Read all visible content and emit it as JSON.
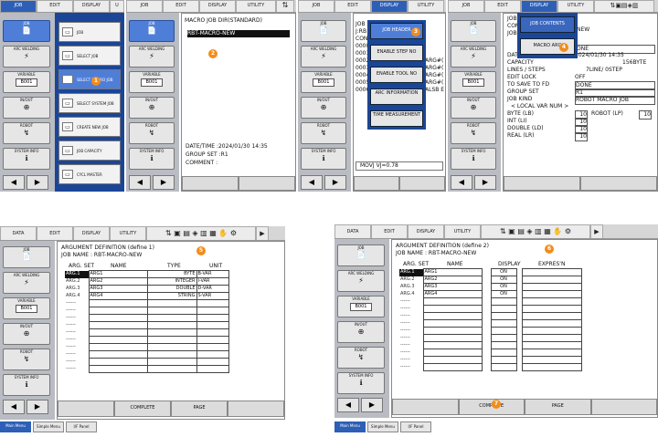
{
  "tabs": {
    "job": "JOB",
    "edit": "EDIT",
    "display": "DISPLAY",
    "utility": "UTILITY",
    "data": "DATA"
  },
  "mainmenu": [
    {
      "label": "JOB",
      "icon": "📄"
    },
    {
      "label": "ARC WELDING",
      "icon": "⚡"
    },
    {
      "label": "VARIABLE",
      "sub": "B001"
    },
    {
      "label": "IN/OUT",
      "icon": "⊕"
    },
    {
      "label": "ROBOT",
      "icon": "↯"
    },
    {
      "label": "SYSTEM INFO",
      "icon": "ℹ"
    }
  ],
  "jobmenu": [
    "JOB",
    "SELECT JOB",
    "SELECT MACRO JOB",
    "SELECT SYSTEM JOB",
    "CREATE NEW JOB",
    "JOB CAPACITY",
    "CYCL MASTER"
  ],
  "macrodir": {
    "title": "MACRO JOB DIR(STANDARD)",
    "item": "RBT-MACRO-NEW",
    "date": "DATE/TIME  :2024/01/30 14:35",
    "group": "GROUP SET  :R1",
    "comment": "COMMENT    :"
  },
  "editpanel": {
    "lines": [
      "JOB",
      "J:RB",
      "CONTE",
      "0000",
      "0001",
      "0002",
      "0003",
      "0004",
      "0005",
      "0006"
    ],
    "right": [
      "ARG#(",
      "ARG#(",
      "ARG#(",
      "ARG#(",
      "ALSB E"
    ],
    "mov": "MOVJ VJ=0.78"
  },
  "popup1": [
    "JOB HEADER",
    "ENABLE STEP NO",
    "ENABLE TOOL NO",
    "ARC INFORMATION",
    "TIME MEASUREMENT"
  ],
  "popup2": [
    "JOB CONTENTS",
    "MACRO ARG"
  ],
  "header": {
    "jobname": "NEW",
    "lines": [
      [
        "JOB",
        ""
      ],
      [
        "COMM",
        ""
      ],
      [
        "JOB",
        ""
      ],
      [
        "DATE",
        "2024/01/30 14:35"
      ],
      [
        "CAPACITY",
        "156BYTE"
      ],
      [
        "LINES / STEPS",
        "7LINE/   0STEP"
      ],
      [
        "EDIT LOCK",
        "OFF"
      ],
      [
        "TO SAVE TO FD",
        "DONE"
      ],
      [
        "GROUP SET",
        "R1"
      ],
      [
        "JOB KIND",
        "ROBOT MACRO JOB"
      ],
      [
        "< LOCAL VAR NUM >",
        ""
      ],
      [
        "BYTE (LB)",
        "10"
      ],
      [
        "INT (LI)",
        "10"
      ],
      [
        "DOUBLE (LD)",
        "10"
      ],
      [
        "REAL (LR)",
        "10"
      ]
    ],
    "robot": "ROBOT (LP)",
    "robotval": "10",
    "caption": "ONE"
  },
  "arg1": {
    "title": "ARGUMENT DEFINITION (define 1)",
    "jobname": "JOB NAME  : RBT-MACRO-NEW",
    "cols": [
      "ARG. SET",
      "NAME",
      "TYPE",
      "UNIT"
    ],
    "rows": [
      [
        "ARG.1",
        "ARG1",
        "BYTE",
        "B-VAR"
      ],
      [
        "ARG.2",
        "ARG2",
        "INTEGER",
        "I-VAR"
      ],
      [
        "ARG.3",
        "ARG3",
        "DOUBLE",
        "D-VAR"
      ],
      [
        "ARG.4",
        "ARG4",
        "STRING",
        "S-VAR"
      ]
    ],
    "blank": "------"
  },
  "arg2": {
    "title": "ARGUMENT DEFINITION (define 2)",
    "jobname": "JOB NAME  : RBT-MACRO-NEW",
    "cols": [
      "ARG. SET",
      "NAME",
      "DISPLAY",
      "EXPRES'N"
    ],
    "rows": [
      [
        "ARG.1",
        "ARG1",
        "ON",
        ""
      ],
      [
        "ARG.2",
        "ARG2",
        "ON",
        ""
      ],
      [
        "ARG.3",
        "ARG3",
        "ON",
        ""
      ],
      [
        "ARG.4",
        "ARG4",
        "ON",
        ""
      ]
    ],
    "blank": "------"
  },
  "bottom": {
    "complete": "COMPLETE",
    "page": "PAGE"
  },
  "footer": {
    "main": "Main Menu",
    "simple": "Simple Menu",
    "panel": "I/F Panel"
  },
  "badges": [
    "1",
    "2",
    "3",
    "4",
    "5",
    "6",
    "7"
  ]
}
